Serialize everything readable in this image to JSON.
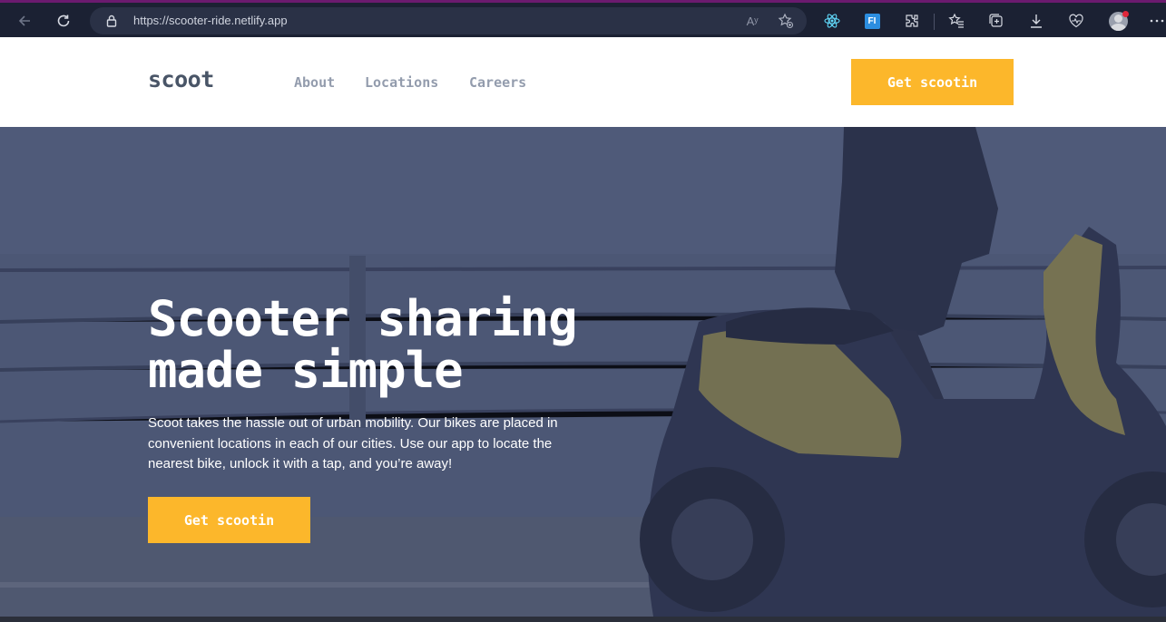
{
  "browser": {
    "url": "https://scooter-ride.netlify.app",
    "icons": [
      "back-icon",
      "refresh-icon",
      "lock-icon",
      "read-aloud-icon",
      "add-favorite-icon",
      "react-devtools-icon",
      "extension-fi-icon",
      "extensions-icon",
      "favorites-icon",
      "collections-icon",
      "downloads-icon",
      "performance-icon",
      "profile-avatar",
      "more-icon"
    ],
    "read_aloud_glyph": "Aʸ",
    "fi_label": "FI"
  },
  "site": {
    "logo": "scoot",
    "nav": [
      {
        "label": "About"
      },
      {
        "label": "Locations"
      },
      {
        "label": "Careers"
      }
    ],
    "header_cta": "Get scootin",
    "hero": {
      "title_line1": "Scooter sharing",
      "title_line2": "made simple",
      "text": "Scoot takes the hassle out of urban mobility. Our bikes are placed in convenient locations in each of our cities. Use our app to locate the nearest bike, unlock it with a tap, and you’re away!",
      "cta": "Get scootin"
    }
  },
  "colors": {
    "accent": "#fcb72b",
    "logo": "#495567",
    "nav": "#939cad",
    "chrome_bg": "#1b2133"
  }
}
